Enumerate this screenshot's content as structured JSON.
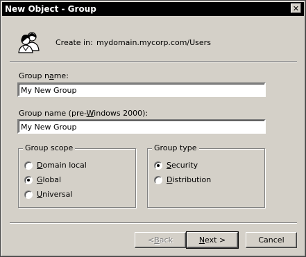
{
  "window": {
    "title": "New Object - Group",
    "close_glyph": "✕"
  },
  "header": {
    "icon": "group-icon",
    "create_in_label": "Create in:",
    "create_in_path": "mydomain.mycorp.com/Users"
  },
  "form": {
    "group_name": {
      "label_pre": "Group n",
      "label_accel": "a",
      "label_post": "me:",
      "value": "My New Group"
    },
    "group_name_pre2000": {
      "label_pre": "Group name (pre-",
      "label_accel": "W",
      "label_post": "indows 2000):",
      "value": "My New Group"
    }
  },
  "group_scope": {
    "title": "Group scope",
    "options": [
      {
        "accel": "D",
        "rest": "omain local",
        "checked": false
      },
      {
        "accel": "G",
        "rest": "lobal",
        "checked": true
      },
      {
        "accel": "U",
        "rest": "niversal",
        "checked": false
      }
    ]
  },
  "group_type": {
    "title": "Group type",
    "options": [
      {
        "accel": "S",
        "rest": "ecurity",
        "checked": true
      },
      {
        "accel": "D",
        "rest": "istribution",
        "checked": false
      }
    ]
  },
  "buttons": {
    "back": {
      "pre": "< ",
      "accel": "B",
      "post": "ack",
      "enabled": false
    },
    "next": {
      "pre": "",
      "accel": "N",
      "post": "ext >",
      "enabled": true
    },
    "cancel": {
      "label": "Cancel",
      "enabled": true
    }
  }
}
